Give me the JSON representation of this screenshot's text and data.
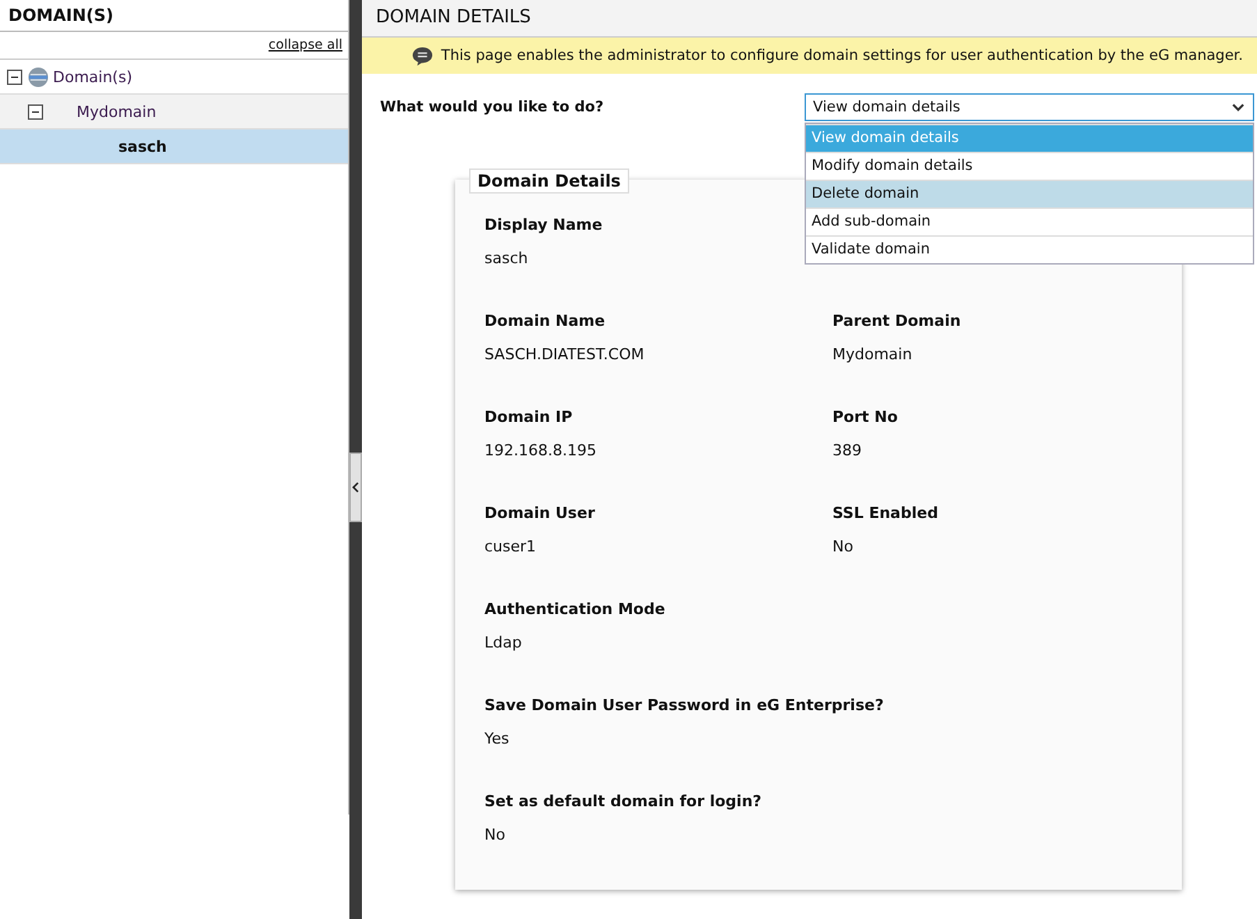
{
  "sidebar": {
    "title": "DOMAIN(S)",
    "collapse_link": "collapse all",
    "tree": [
      {
        "label": "Domain(s)",
        "expanded": true,
        "selected": false,
        "children": [
          {
            "label": "Mydomain",
            "expanded": true,
            "selected": false,
            "children": [
              {
                "label": "sasch",
                "selected": true
              }
            ]
          }
        ]
      }
    ]
  },
  "main": {
    "title": "DOMAIN DETAILS",
    "info_banner": "This page enables the administrator to configure domain settings for user authentication by the eG manager.",
    "question": "What would you like to do?",
    "select": {
      "value": "View domain details",
      "expanded": true,
      "options": [
        {
          "label": "View domain details",
          "selected": true,
          "highlighted": false
        },
        {
          "label": "Modify domain details",
          "selected": false,
          "highlighted": false
        },
        {
          "label": "Delete domain",
          "selected": false,
          "highlighted": true
        },
        {
          "label": "Add sub-domain",
          "selected": false,
          "highlighted": false
        },
        {
          "label": "Validate domain",
          "selected": false,
          "highlighted": false
        }
      ]
    },
    "details": {
      "legend": "Domain Details",
      "fields": [
        {
          "kind": "half",
          "label": "Display Name",
          "value": "sasch"
        },
        {
          "kind": "gap"
        },
        {
          "kind": "half",
          "label": "Domain Name",
          "value": "SASCH.DIATEST.COM"
        },
        {
          "kind": "half",
          "label": "Parent Domain",
          "value": "Mydomain"
        },
        {
          "kind": "half",
          "label": "Domain IP",
          "value": "192.168.8.195"
        },
        {
          "kind": "half",
          "label": "Port No",
          "value": "389"
        },
        {
          "kind": "half",
          "label": "Domain User",
          "value": "cuser1"
        },
        {
          "kind": "half",
          "label": "SSL Enabled",
          "value": "No"
        },
        {
          "kind": "half",
          "label": "Authentication Mode",
          "value": "Ldap"
        },
        {
          "kind": "wide",
          "label": "Save Domain User Password in eG Enterprise?",
          "value": "Yes"
        },
        {
          "kind": "wide",
          "label": "Set as default domain for login?",
          "value": "No"
        }
      ]
    }
  }
}
